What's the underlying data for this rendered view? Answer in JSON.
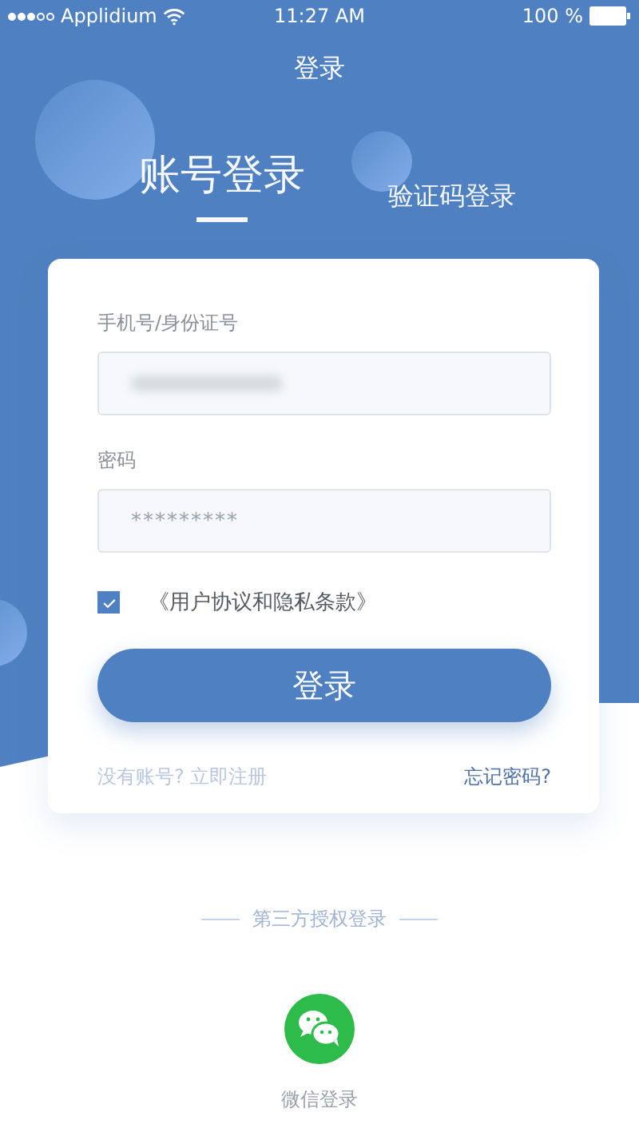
{
  "status_bar": {
    "carrier": "Applidium",
    "time": "11:27 AM",
    "battery": "100 %"
  },
  "nav": {
    "title": "登录"
  },
  "tabs": [
    {
      "label": "账号登录",
      "selected": true
    },
    {
      "label": "验证码登录",
      "selected": false
    }
  ],
  "fields": [
    {
      "label": "手机号/身份证号",
      "kind": "obscured"
    },
    {
      "label": "密码",
      "kind": "password",
      "value": "*********"
    }
  ],
  "agreement": {
    "text": "《用户协议和隐私条款》",
    "checked": true
  },
  "login_button": "登录",
  "links": {
    "register": "没有账号? 立即注册",
    "forgot": "忘记密码?"
  },
  "third_party": {
    "heading": "第三方授权登录",
    "items": [
      {
        "label": "微信登录"
      }
    ]
  }
}
